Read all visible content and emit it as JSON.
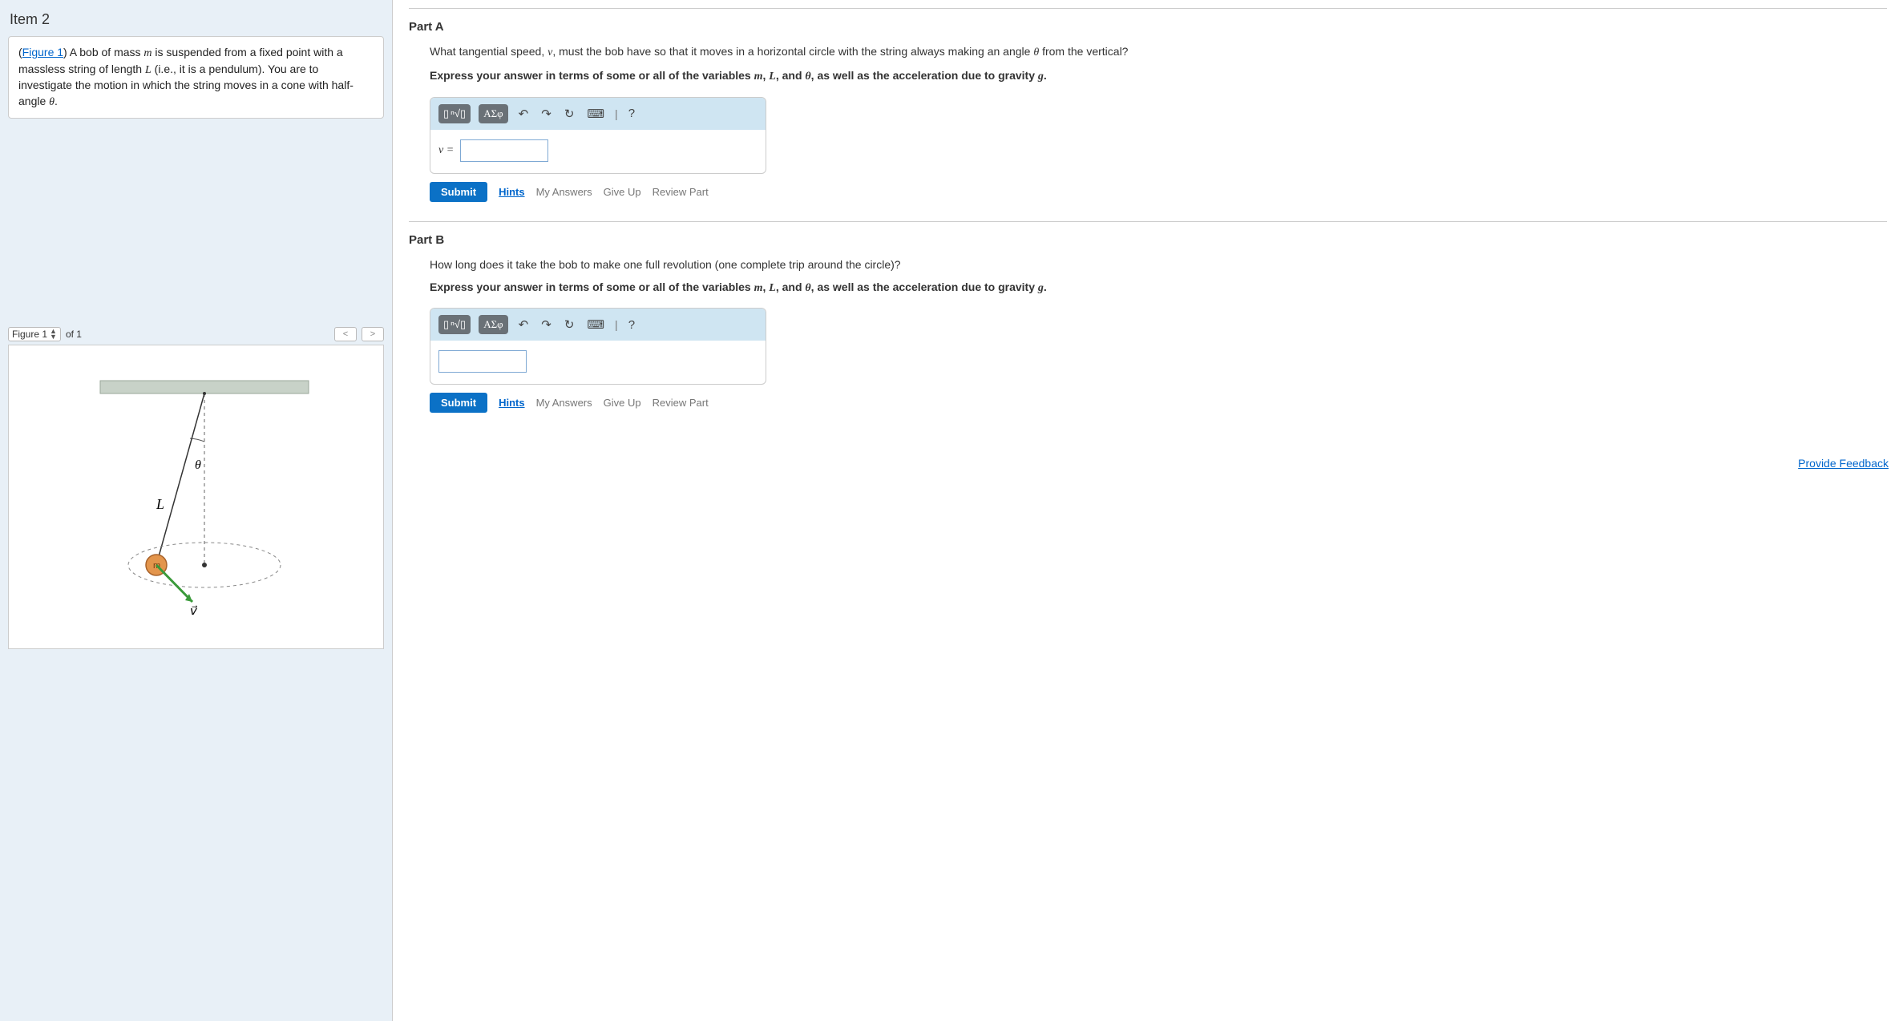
{
  "left": {
    "item_title": "Item 2",
    "problem_prefix": "(",
    "figure_link_text": "Figure 1",
    "problem_rest": ") A bob of mass ",
    "problem_after_m": " is suspended from a fixed point with a massless string of length ",
    "problem_after_L": " (i.e., it is a pendulum). You are to investigate the motion in which the string moves in a cone with half-angle ",
    "problem_end": ".",
    "figure_select_label": "Figure 1",
    "figure_of_label": "of 1",
    "fig_prev": "<",
    "fig_next": ">"
  },
  "parts": {
    "A": {
      "title": "Part A",
      "q1": "What tangential speed, ",
      "q2": ", must the bob have so that it moves in a horizontal circle with the string always making an angle ",
      "q3": " from the vertical?",
      "instr_pre": "Express your answer in terms of some or all of the variables ",
      "instr_mid1": ", ",
      "instr_mid2": ", and ",
      "instr_post": ", as well as the acceleration due to gravity ",
      "instr_end": ".",
      "answer_label": "v ="
    },
    "B": {
      "title": "Part B",
      "q": "How long does it take the bob to make one full revolution (one complete trip around the circle)?",
      "instr_pre": "Express your answer in terms of some or all of the variables ",
      "instr_mid1": ", ",
      "instr_mid2": ", and ",
      "instr_post": ", as well as the acceleration due to gravity ",
      "instr_end": "."
    }
  },
  "vars": {
    "m": "m",
    "L": "L",
    "theta": "θ",
    "v": "v",
    "g": "g"
  },
  "toolbar": {
    "templates_a": "▯",
    "templates_b": "ⁿ√▯",
    "greek": "ΑΣφ",
    "undo": "↶",
    "redo": "↷",
    "reset": "↻",
    "keyboard": "⌨",
    "sep": "|",
    "help": "?"
  },
  "actions": {
    "submit": "Submit",
    "hints": "Hints",
    "my_answers": "My Answers",
    "give_up": "Give Up",
    "review": "Review Part"
  },
  "feedback": "Provide Feedback"
}
